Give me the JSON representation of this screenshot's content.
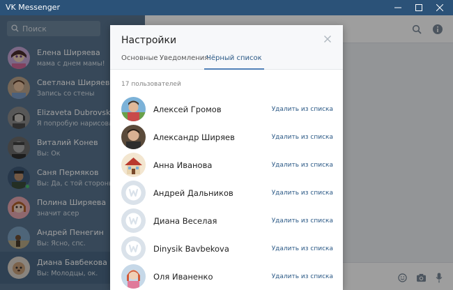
{
  "window": {
    "title": "VK Messenger"
  },
  "search": {
    "placeholder": "Поиск"
  },
  "dialogs": [
    {
      "name": "Елена Ширяева",
      "last": "мама с днем мамы!",
      "online": false,
      "active": false
    },
    {
      "name": "Светлана Ширяева",
      "last": "Запись со стены",
      "online": false,
      "active": false
    },
    {
      "name": "Elizaveta Dubrovskaya",
      "last": "Я попробую нарисовать",
      "online": false,
      "active": false
    },
    {
      "name": "Виталий Конев",
      "last": "Вы: Ок",
      "online": false,
      "active": false
    },
    {
      "name": "Саня Пермяков",
      "last": "Вы: Да, с той стороны тр",
      "online": true,
      "active": false
    },
    {
      "name": "Полина Ширяева",
      "last": "значит асер",
      "online": false,
      "active": false
    },
    {
      "name": "Андрей Пенегин",
      "last": "Вы: Ясно, спс.",
      "online": false,
      "active": false
    },
    {
      "name": "Диана Бавбекова",
      "last": "Вы: Молодцы, ок.",
      "online": false,
      "active": true
    }
  ],
  "modal": {
    "title": "Настройки",
    "tabs": [
      {
        "label": "Основные",
        "active": false
      },
      {
        "label": "Уведомления",
        "active": false
      },
      {
        "label": "Чёрный список",
        "active": true
      }
    ],
    "count_label": "17 пользователей",
    "remove_label": "Удалить из списка",
    "users": [
      {
        "name": "Алексей Громов",
        "avatar": "photo"
      },
      {
        "name": "Александр Ширяев",
        "avatar": "photo"
      },
      {
        "name": "Анна Иванова",
        "avatar": "photo"
      },
      {
        "name": "Андрей Дальников",
        "avatar": "default"
      },
      {
        "name": "Диана Веселая",
        "avatar": "default"
      },
      {
        "name": "Dinysik Bavbekova",
        "avatar": "default"
      },
      {
        "name": "Оля Иваненко",
        "avatar": "photo"
      }
    ]
  },
  "icons": {
    "search": "search-icon",
    "info": "info-icon",
    "close": "close-icon",
    "emoji": "emoji-icon",
    "camera": "camera-icon",
    "mic": "microphone-icon"
  },
  "colors": {
    "titlebar": "#2b5278",
    "sidebar": "#5a7590",
    "accent": "#5181b8",
    "link": "#2a5885"
  }
}
